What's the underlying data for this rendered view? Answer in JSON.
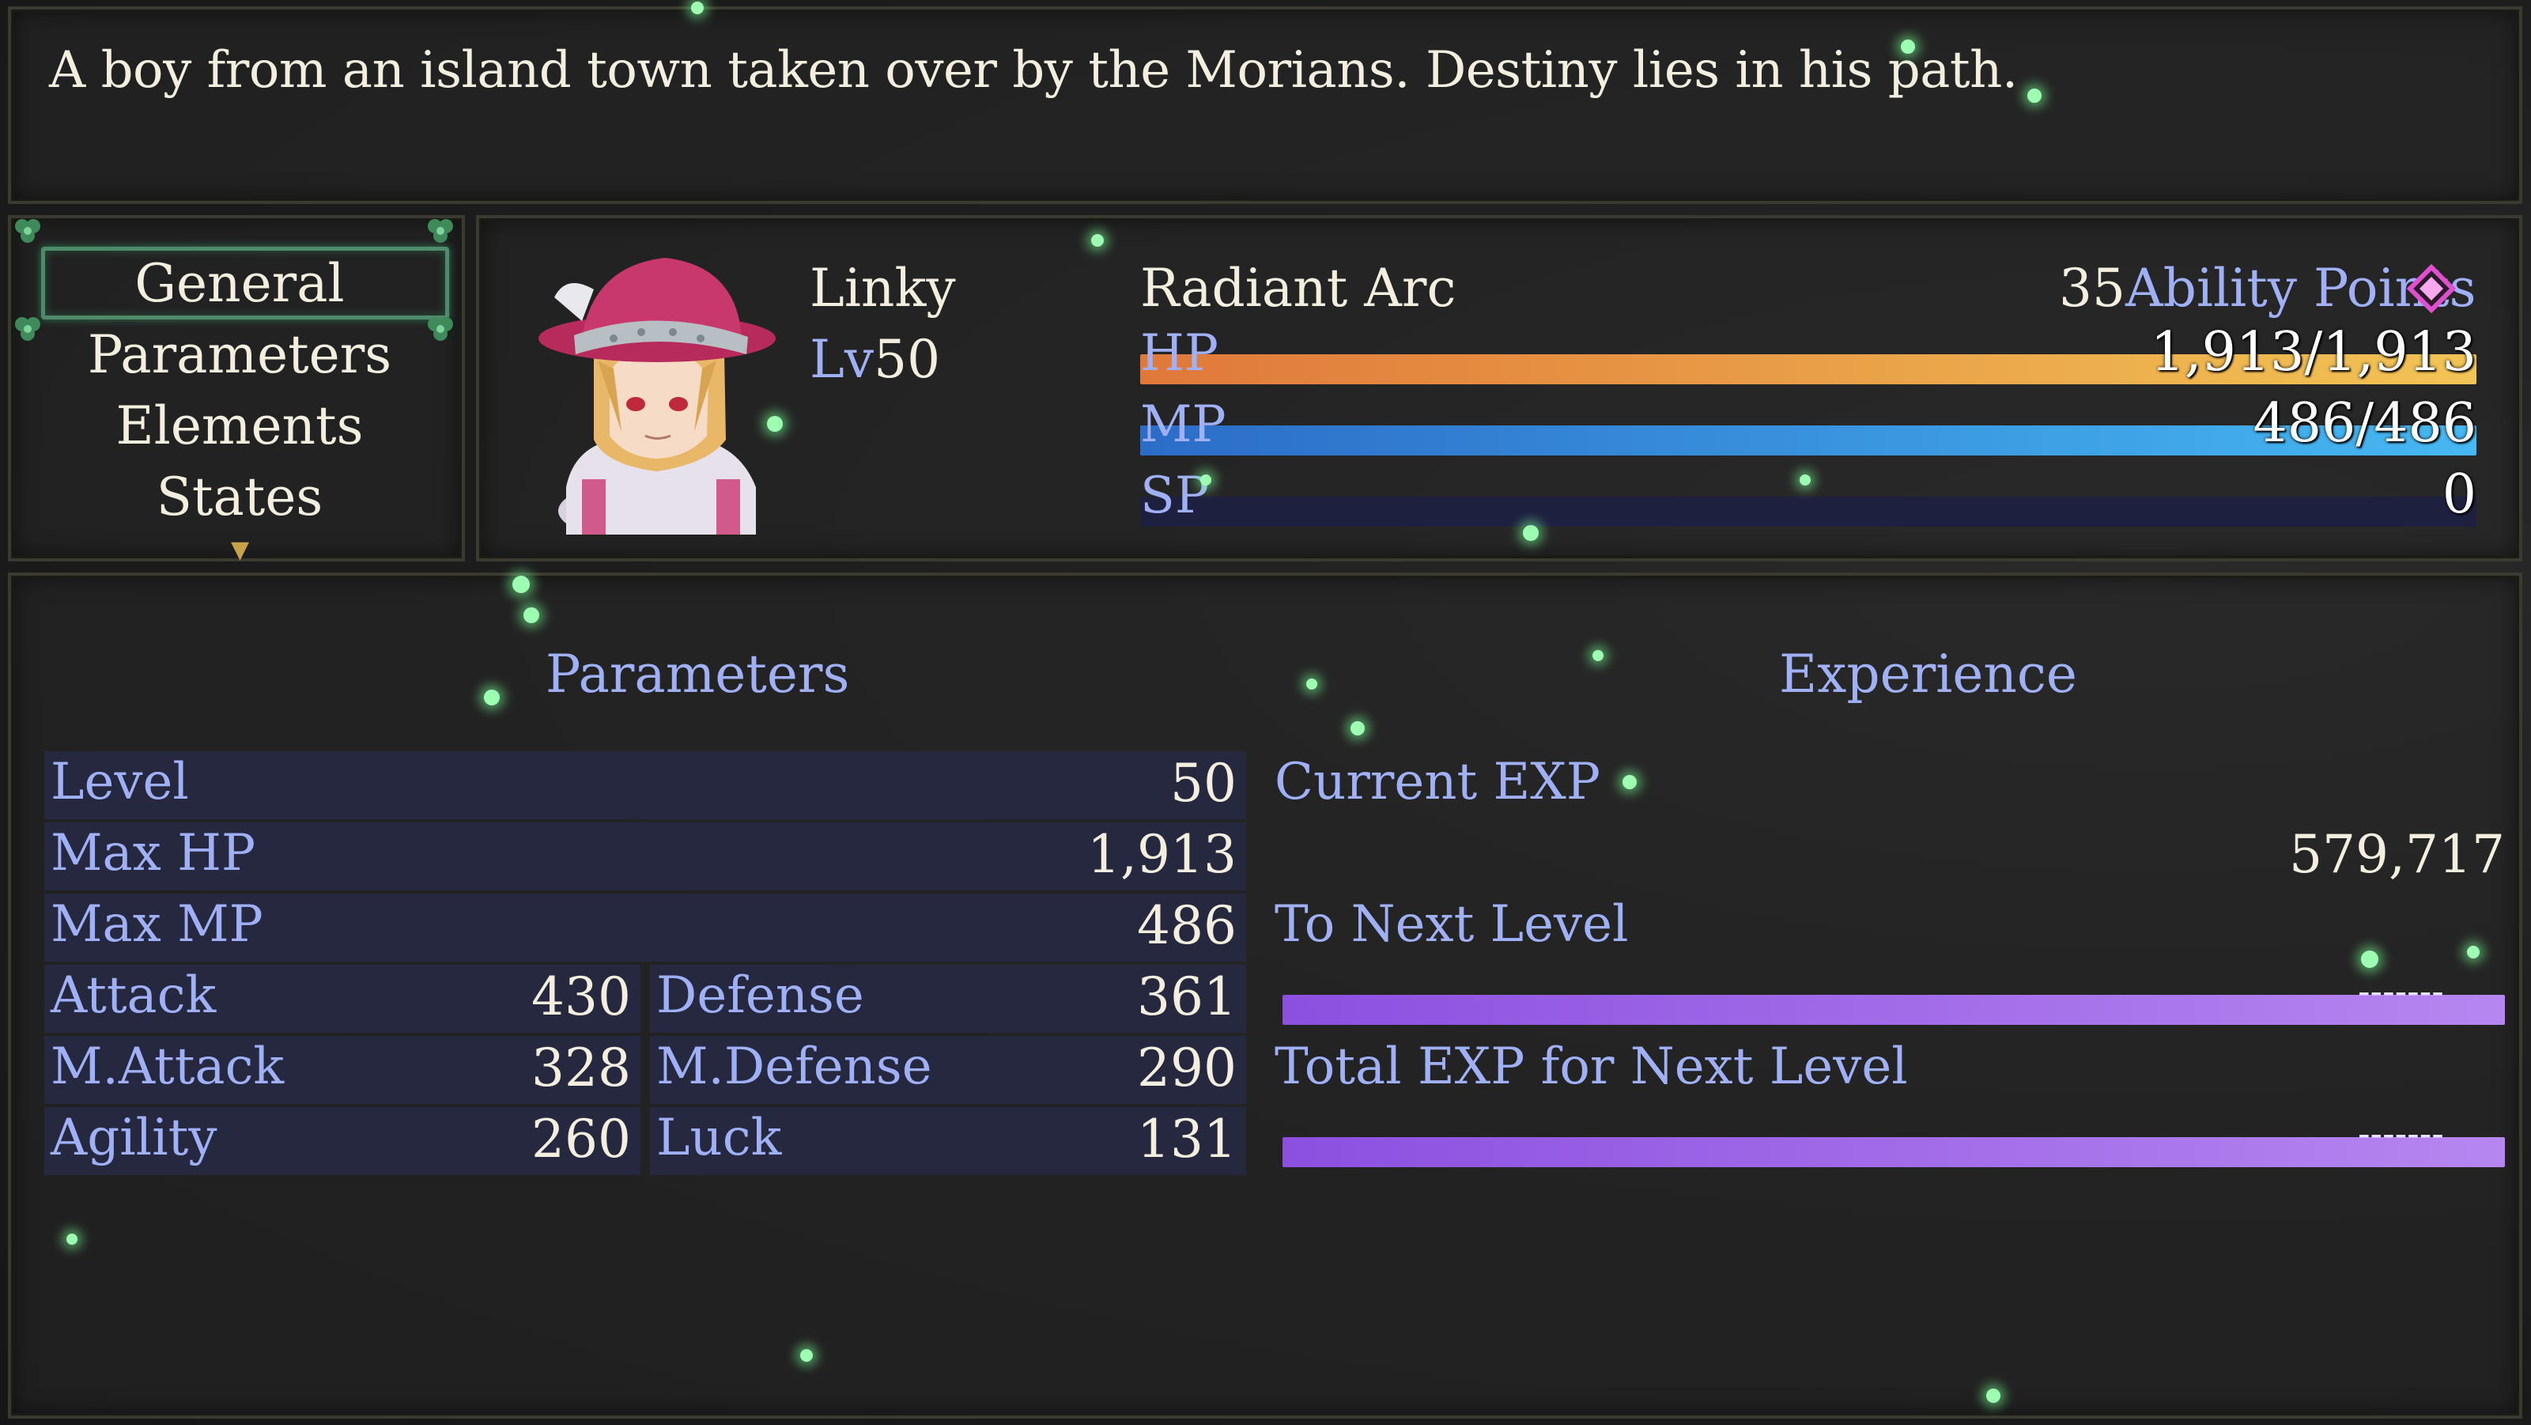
{
  "help": {
    "text": "A boy from an island town taken over by the Morians. Destiny lies in his path."
  },
  "commands": {
    "items": [
      "General",
      "Parameters",
      "Elements",
      "States"
    ],
    "selected": "General"
  },
  "actor": {
    "name": "Linky",
    "level_label": "Lv",
    "level": "50",
    "class_name": "Radiant Arc",
    "ability_points": "35",
    "ability_points_label": "Ability Points",
    "hp_label": "HP",
    "hp_text": "1,913/1,913",
    "hp_fraction": 1.0,
    "mp_label": "MP",
    "mp_text": "486/486",
    "mp_fraction": 1.0,
    "sp_label": "SP",
    "sp_text": "0",
    "sp_fraction": 0.0
  },
  "parameters": {
    "title": "Parameters",
    "full_rows": [
      {
        "label": "Level",
        "value": "50"
      },
      {
        "label": "Max HP",
        "value": "1,913"
      },
      {
        "label": "Max MP",
        "value": "486"
      }
    ],
    "pair_rows": [
      {
        "left_label": "Attack",
        "left_value": "430",
        "right_label": "Defense",
        "right_value": "361"
      },
      {
        "left_label": "M.Attack",
        "left_value": "328",
        "right_label": "M.Defense",
        "right_value": "290"
      },
      {
        "left_label": "Agility",
        "left_value": "260",
        "right_label": "Luck",
        "right_value": "131"
      }
    ]
  },
  "experience": {
    "title": "Experience",
    "current_label": "Current EXP",
    "current_value": "579,717",
    "next_label": "To Next Level",
    "next_value": "-------",
    "total_label": "Total EXP for Next Level",
    "total_value": "-------"
  },
  "colors": {
    "system_blue": "#9fb0f6",
    "hp_gradient": [
      "#e0783a",
      "#f2c455"
    ],
    "mp_gradient": [
      "#2c6cc8",
      "#46b8f2"
    ],
    "exp_bar": "#a674ea",
    "selection_border": "#4f8a6a",
    "ap_gem": "#e04fd0"
  }
}
